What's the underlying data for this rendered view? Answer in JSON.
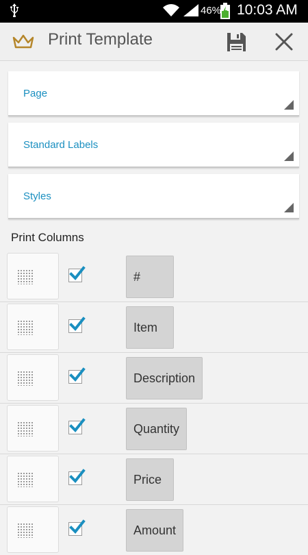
{
  "status_bar": {
    "battery_percent": "46%",
    "time": "10:03 AM",
    "icons": [
      "usb-icon",
      "wifi-icon",
      "signal-icon",
      "battery-charging-icon"
    ]
  },
  "action_bar": {
    "title": "Print Template",
    "icons": [
      "crown-icon",
      "save-icon",
      "close-icon"
    ],
    "icon_color": "#b5862a"
  },
  "dropdowns": [
    {
      "label": "Page"
    },
    {
      "label": "Standard Labels"
    },
    {
      "label": "Styles"
    }
  ],
  "accent_color": "#1a8fc0",
  "print_columns": {
    "title": "Print Columns",
    "items": [
      {
        "label": "#",
        "checked": true
      },
      {
        "label": "Item",
        "checked": true
      },
      {
        "label": "Description",
        "checked": true
      },
      {
        "label": "Quantity",
        "checked": true
      },
      {
        "label": "Price",
        "checked": true
      },
      {
        "label": "Amount",
        "checked": true
      }
    ]
  }
}
